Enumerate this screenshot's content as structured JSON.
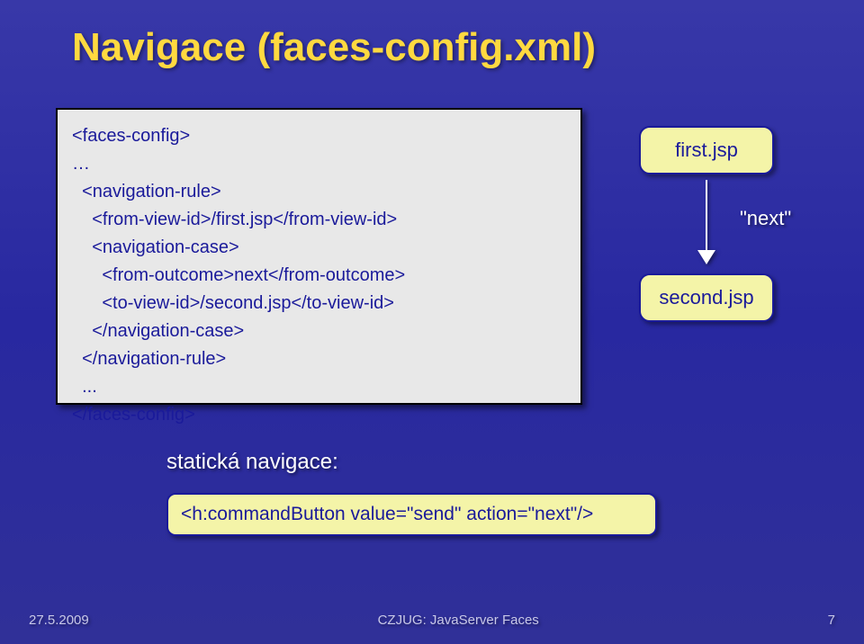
{
  "title": "Navigace (faces-config.xml)",
  "code": "<faces-config>\n…\n  <navigation-rule>\n    <from-view-id>/first.jsp</from-view-id>\n    <navigation-case>\n      <from-outcome>next</from-outcome>\n      <to-view-id>/second.jsp</to-view-id>\n    </navigation-case>\n  </navigation-rule>\n  ...\n</faces-config>",
  "flow": {
    "node1": "first.jsp",
    "edge_label": "\"next\"",
    "node2": "second.jsp"
  },
  "static_nav_label": "statická navigace:",
  "command_button": "<h:commandButton value=\"send\" action=\"next\"/>",
  "footer": {
    "date": "27.5.2009",
    "center": "CZJUG: JavaServer Faces",
    "page": "7"
  }
}
